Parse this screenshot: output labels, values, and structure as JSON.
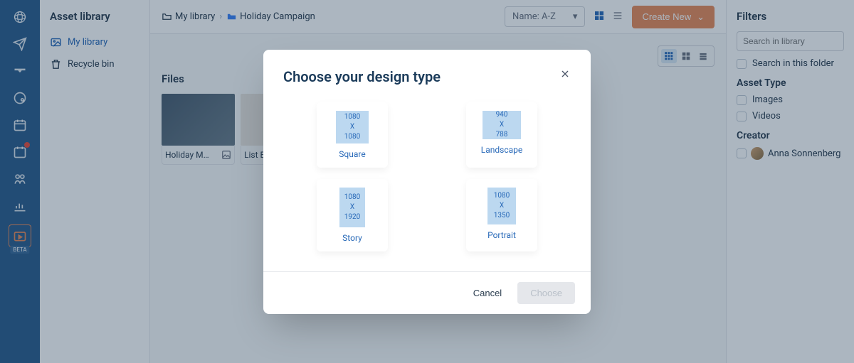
{
  "sidebar": {
    "title": "Asset library",
    "items": [
      {
        "label": "My library"
      },
      {
        "label": "Recycle bin"
      }
    ]
  },
  "toolbar": {
    "breadcrumb": [
      {
        "label": "My library"
      },
      {
        "label": "Holiday Campaign"
      }
    ],
    "sort_label": "Name: A-Z",
    "create_label": "Create New"
  },
  "content": {
    "section_title": "Files",
    "files": [
      {
        "name": "Holiday M…"
      },
      {
        "name": "List B"
      }
    ]
  },
  "filters": {
    "title": "Filters",
    "search_placeholder": "Search in library",
    "search_folder_label": "Search in this folder",
    "asset_type_title": "Asset Type",
    "asset_types": [
      {
        "label": "Images"
      },
      {
        "label": "Videos"
      }
    ],
    "creator_title": "Creator",
    "creators": [
      {
        "label": "Anna Sonnenberg"
      }
    ]
  },
  "modal": {
    "title": "Choose your design type",
    "designs": {
      "square": {
        "w": "1080",
        "x": "X",
        "h": "1080",
        "label": "Square"
      },
      "landscape": {
        "w": "940",
        "x": "X",
        "h": "788",
        "label": "Landscape"
      },
      "story": {
        "w": "1080",
        "x": "X",
        "h": "1920",
        "label": "Story"
      },
      "portrait": {
        "w": "1080",
        "x": "X",
        "h": "1350",
        "label": "Portrait"
      }
    },
    "cancel_label": "Cancel",
    "choose_label": "Choose"
  }
}
